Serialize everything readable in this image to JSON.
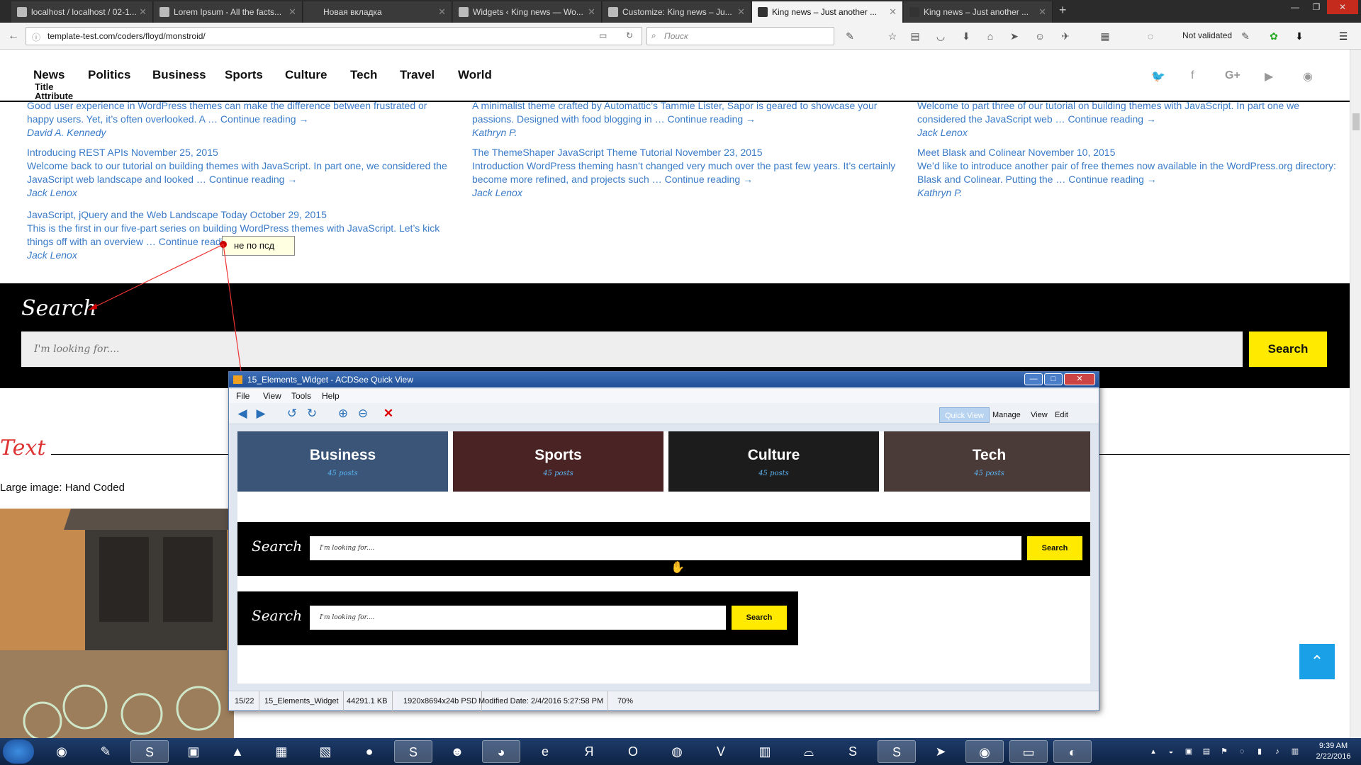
{
  "browser": {
    "tabs": [
      {
        "title": "localhost / localhost / 02-1...",
        "active": false
      },
      {
        "title": "Lorem Ipsum - All the facts...",
        "active": false
      },
      {
        "title": "Новая вкладка",
        "active": false
      },
      {
        "title": "Widgets ‹ King news — Wo...",
        "active": false
      },
      {
        "title": "Customize: King news – Ju...",
        "active": false
      },
      {
        "title": "King news – Just another ...",
        "active": true
      },
      {
        "title": "King news – Just another ...",
        "active": false
      }
    ],
    "url": "template-test.com/coders/floyd/monstroid/",
    "search_placeholder": "Поиск",
    "validator_status": "Not validated"
  },
  "site": {
    "menu": [
      "News",
      "Politics",
      "Business",
      "Sports",
      "Culture",
      "Tech",
      "Travel",
      "World"
    ],
    "menu_tooltip": "Title Attribute",
    "social_icons": [
      "twitter-icon",
      "facebook-icon",
      "google-plus-icon",
      "youtube-icon",
      "rss-icon"
    ],
    "posts": [
      {
        "title": "",
        "excerpt": "Good user experience in WordPress themes can make the difference between frustrated or happy users. Yet, it’s often overlooked. A … Continue reading →",
        "author": "David A. Kennedy"
      },
      {
        "title": "",
        "excerpt": "A minimalist theme crafted by Automattic’s Tammie Lister, Sapor is geared to showcase your passions. Designed with food blogging in … Continue reading →",
        "author": "Kathryn P."
      },
      {
        "title": "",
        "excerpt": "Welcome to part three of our tutorial on building themes with JavaScript. In part one we considered the JavaScript web … Continue reading →",
        "author": "Jack Lenox"
      },
      {
        "title": "Introducing REST APIs November 25, 2015",
        "excerpt": "Welcome back to our tutorial on building themes with JavaScript. In part one, we considered the JavaScript web landscape and looked … Continue reading →",
        "author": "Jack Lenox"
      },
      {
        "title": "The ThemeShaper JavaScript Theme Tutorial November 23, 2015",
        "excerpt": "Introduction WordPress theming hasn’t changed very much over the past few years. It’s certainly become more refined, and projects such … Continue reading →",
        "author": "Jack Lenox"
      },
      {
        "title": "Meet Blask and Colinear November 10, 2015",
        "excerpt": "We’d like to introduce another pair of free themes now available in the WordPress.org directory: Blask and Colinear. Putting the … Continue reading →",
        "author": "Kathryn P."
      },
      {
        "title": "JavaScript, jQuery and the Web Landscape Today October 29, 2015",
        "excerpt": "This is the first in our five-part series on building WordPress themes with JavaScript. Let’s kick things off with an overview … Continue reading →",
        "author": "Jack Lenox"
      }
    ],
    "search_widget": {
      "heading": "Search",
      "placeholder": "I'm looking for....",
      "button": "Search"
    },
    "text_widget_heading": "Text",
    "large_image_label": "Large image: Hand Coded",
    "annotation_note": "не по псд"
  },
  "acdsee": {
    "title": "15_Elements_Widget - ACDSee Quick View",
    "menu": [
      "File",
      "View",
      "Tools",
      "Help"
    ],
    "modes": [
      "Quick View",
      "Manage",
      "View",
      "Edit"
    ],
    "categories": [
      {
        "name": "Business",
        "posts": "45 posts"
      },
      {
        "name": "Sports",
        "posts": "45 posts"
      },
      {
        "name": "Culture",
        "posts": "45 posts"
      },
      {
        "name": "Tech",
        "posts": "45 posts"
      }
    ],
    "search_wide": {
      "heading": "Search",
      "placeholder": "I'm looking for....",
      "button": "Search"
    },
    "search_narrow": {
      "heading": "Search",
      "placeholder": "I'm looking for....",
      "button": "Search"
    },
    "status": [
      "15/22",
      "15_Elements_Widget",
      "44291.1 KB",
      "1920x8694x24b PSD",
      "Modified Date: 2/4/2016 5:27:58 PM",
      "70%"
    ]
  },
  "taskbar": {
    "clock_time": "9:39 AM",
    "clock_date": "2/22/2016"
  },
  "colors": {
    "accent_yellow": "#ffea00",
    "link_blue": "#3a7bc8",
    "text_red": "#dd3333",
    "totop_blue": "#1aa0e6"
  }
}
